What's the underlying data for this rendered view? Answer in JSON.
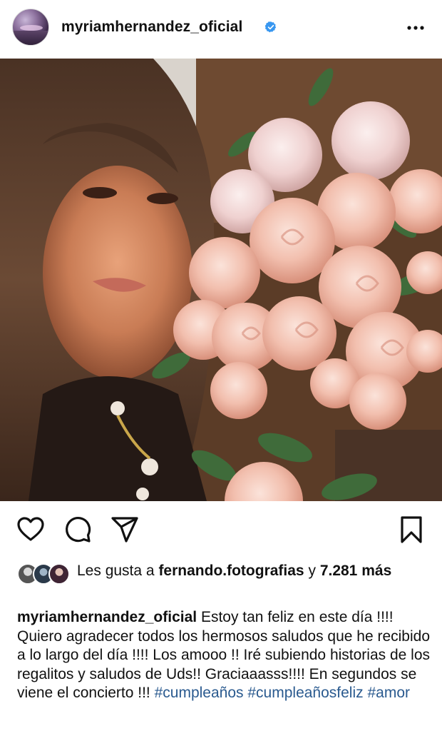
{
  "post": {
    "username": "myriamhernandez_oficial",
    "verified": true
  },
  "likes": {
    "prefix": "Les gusta a",
    "user": "fernando.fotografias",
    "connector": "y",
    "count": "7.281",
    "suffix": "más"
  },
  "caption": {
    "username": "myriamhernandez_oficial",
    "text": "Estoy tan feliz en este día !!!! Quiero agradecer todos los hermosos saludos que he recibido a lo largo del día !!!! Los amooo !! Iré subiendo historias de los regalitos y saludos de Uds!! Graciaaasss!!!! En segundos se viene el concierto !!!",
    "hashtags": [
      "#cumpleaños",
      "#cumpleañosfeliz",
      "#amor"
    ]
  },
  "icons": {
    "verified": "verified-badge-icon",
    "more": "more-options-icon",
    "like": "heart-icon",
    "comment": "comment-icon",
    "share": "send-icon",
    "save": "bookmark-icon"
  },
  "colors": {
    "verified": "#3897f0",
    "hashtag": "#2a5a8f",
    "text": "#111111"
  }
}
